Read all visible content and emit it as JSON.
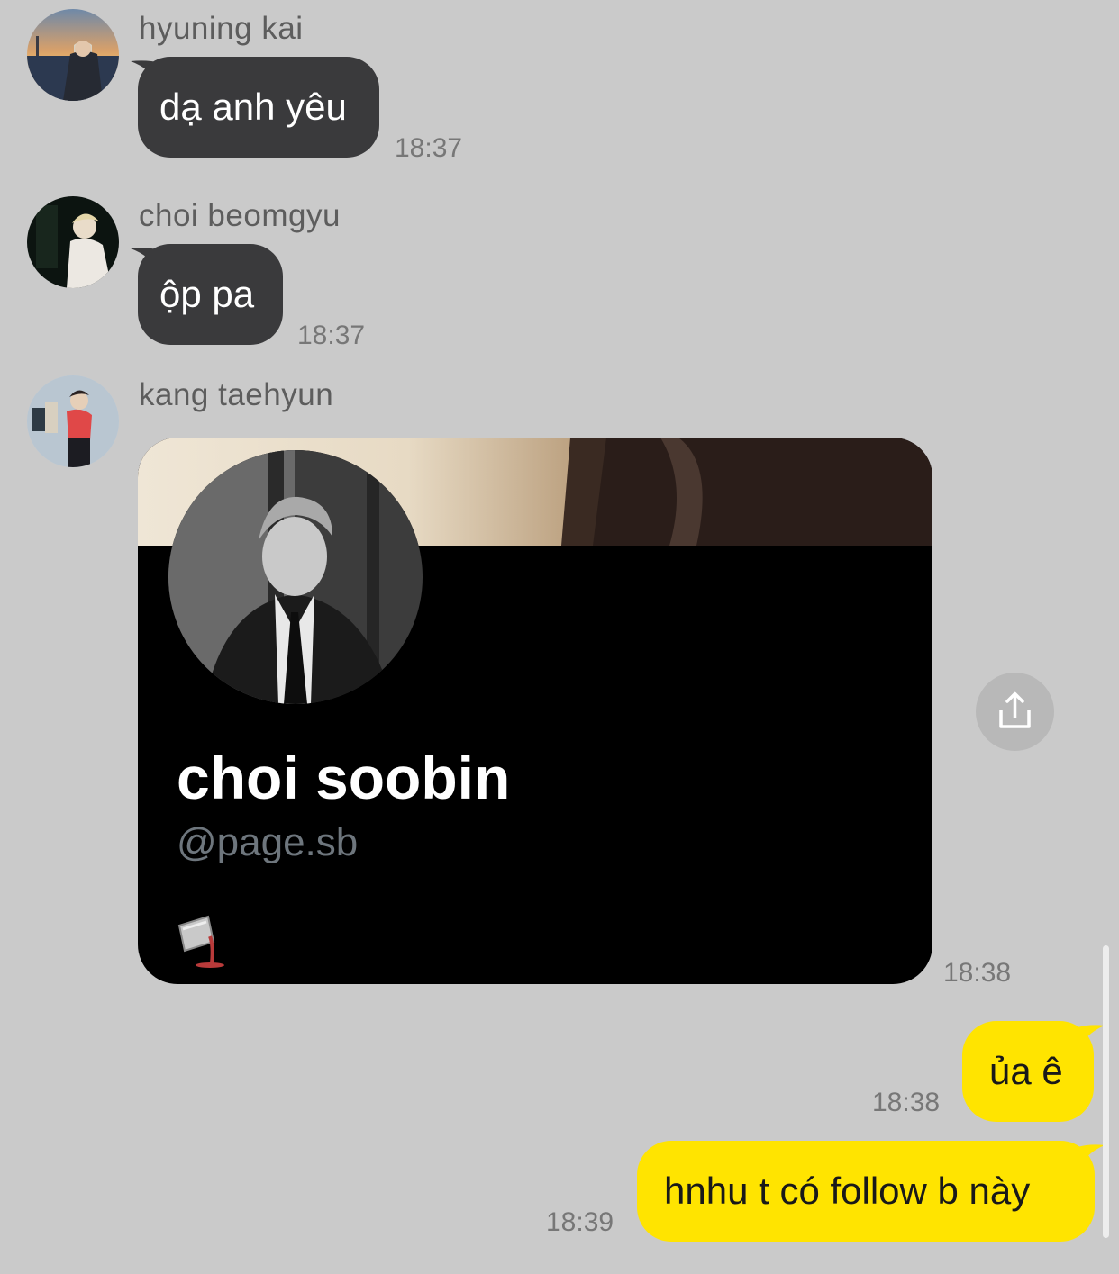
{
  "colors": {
    "background": "#cacaca",
    "incoming_bubble": "#3a3a3c",
    "outgoing_bubble": "#ffe400",
    "timestamp": "#777777",
    "sender_name": "#5d5d5d"
  },
  "messages": [
    {
      "sender": "hyuning kai",
      "avatar_icon": "profile-photo",
      "text": "dạ anh yêu",
      "time": "18:37"
    },
    {
      "sender": "choi beomgyu",
      "avatar_icon": "profile-photo",
      "text": "ộp pa",
      "time": "18:37"
    },
    {
      "sender": "kang taehyun",
      "avatar_icon": "profile-photo",
      "time": "18:38",
      "shared_card": {
        "name": "choi soobin",
        "handle": "@page.sb",
        "emoji_icon": "spilled-cup-icon"
      }
    }
  ],
  "share_button": {
    "icon": "share-icon"
  },
  "outgoing": [
    {
      "text": "ủa ê",
      "time": "18:38"
    },
    {
      "text": "hnhu t có follow b này",
      "time": "18:39"
    }
  ]
}
